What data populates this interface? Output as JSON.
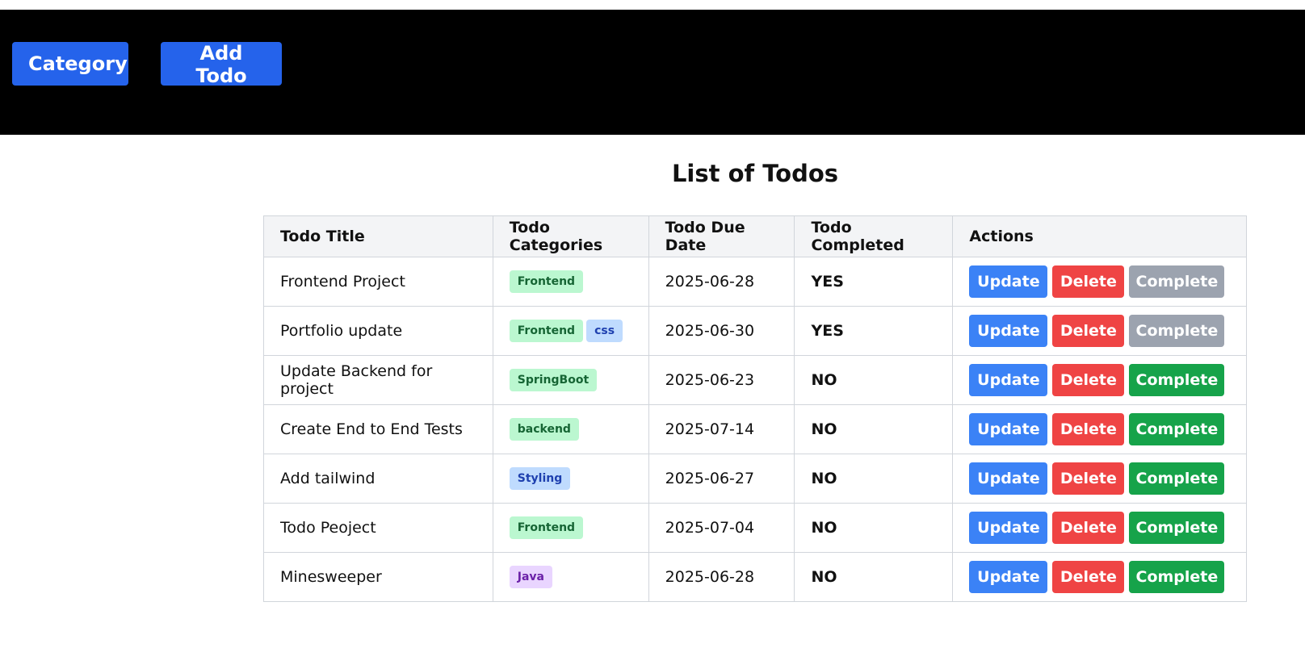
{
  "nav": {
    "category_label": "Category",
    "add_todo_label": "Add Todo",
    "button_color": "#2563eb",
    "bar_color": "#000000"
  },
  "page_title": "List of Todos",
  "table": {
    "headers": [
      "Todo Title",
      "Todo Categories",
      "Todo Due Date",
      "Todo Completed",
      "Actions"
    ],
    "actions": {
      "update": "Update",
      "delete": "Delete",
      "complete": "Complete"
    },
    "colors": {
      "update": "#3b82f6",
      "delete": "#ef4444",
      "complete_active": "#16a34a",
      "complete_disabled": "#9ca3af"
    },
    "rows": [
      {
        "title": "Frontend Project",
        "categories": [
          {
            "name": "Frontend",
            "bg": "#bbf7d0",
            "fg": "#166534"
          }
        ],
        "due": "2025-06-28",
        "completed": "YES"
      },
      {
        "title": "Portfolio update",
        "categories": [
          {
            "name": "Frontend",
            "bg": "#bbf7d0",
            "fg": "#166534"
          },
          {
            "name": "css",
            "bg": "#bfdbfe",
            "fg": "#1e40af"
          }
        ],
        "due": "2025-06-30",
        "completed": "YES"
      },
      {
        "title": "Update Backend for project",
        "categories": [
          {
            "name": "SpringBoot",
            "bg": "#bbf7d0",
            "fg": "#166534"
          }
        ],
        "due": "2025-06-23",
        "completed": "NO"
      },
      {
        "title": "Create End to End Tests",
        "categories": [
          {
            "name": "backend",
            "bg": "#bbf7d0",
            "fg": "#166534"
          }
        ],
        "due": "2025-07-14",
        "completed": "NO"
      },
      {
        "title": "Add tailwind",
        "categories": [
          {
            "name": "Styling",
            "bg": "#bfdbfe",
            "fg": "#1e40af"
          }
        ],
        "due": "2025-06-27",
        "completed": "NO"
      },
      {
        "title": "Todo Peoject",
        "categories": [
          {
            "name": "Frontend",
            "bg": "#bbf7d0",
            "fg": "#166534"
          }
        ],
        "due": "2025-07-04",
        "completed": "NO"
      },
      {
        "title": "Minesweeper",
        "categories": [
          {
            "name": "Java",
            "bg": "#e9d5ff",
            "fg": "#6b21a8"
          }
        ],
        "due": "2025-06-28",
        "completed": "NO"
      }
    ]
  }
}
